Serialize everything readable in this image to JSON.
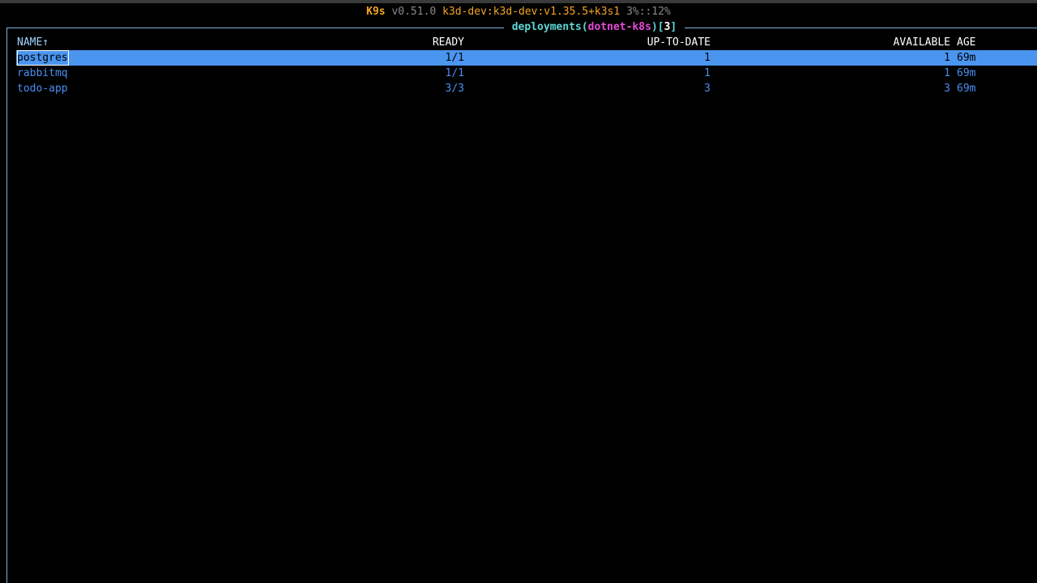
{
  "header": {
    "app_name": "K9s",
    "version": "v0.51.0",
    "context": "k3d-dev:k3d-dev:v1.35.5+k3s1",
    "resources": "3%::12%"
  },
  "frame": {
    "resource": "deployments",
    "open_paren": "(",
    "namespace": "dotnet-k8s",
    "close_paren": ")",
    "open_bracket": "[",
    "count": "3",
    "close_bracket": "]"
  },
  "table": {
    "columns": {
      "name": "NAME↑",
      "ready": "READY",
      "uptodate": "UP-TO-DATE",
      "available": "AVAILABLE",
      "age": "AGE"
    },
    "rows": [
      {
        "name": "postgres",
        "ready": "1/1",
        "uptodate": "1",
        "available": "1",
        "age": "69m"
      },
      {
        "name": "rabbitmq",
        "ready": "1/1",
        "uptodate": "1",
        "available": "1",
        "age": "69m"
      },
      {
        "name": "todo-app",
        "ready": "3/3",
        "uptodate": "3",
        "available": "3",
        "age": "69m"
      }
    ],
    "selected_row": "postgres"
  },
  "colors": {
    "accent_orange": "#f5a524",
    "title_cyan": "#5fd7d7",
    "namespace_magenta": "#e64ad7",
    "row_text_blue": "#4a8ff0",
    "selection_bg": "#4a95f0",
    "border": "#7fb2d8"
  }
}
